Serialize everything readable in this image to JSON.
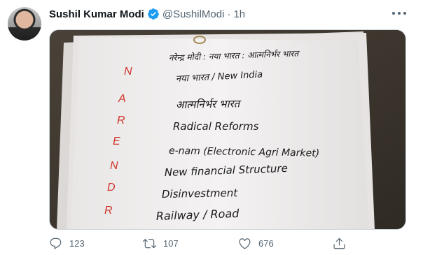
{
  "tweet": {
    "author_name": "Sushil Kumar Modi",
    "handle": "@SushilModi",
    "separator": "·",
    "time": "1h"
  },
  "note": {
    "acrostic_letters": [
      "N",
      "A",
      "R",
      "E",
      "N",
      "D",
      "R"
    ],
    "line1": "नरेन्द्र मोदी : नया भारत : आत्मनिर्भर भारत",
    "line2": "नया भारत / New India",
    "line3": "आत्मनिर्भर भारत",
    "line4": "Radical Reforms",
    "line5": "e-nam (Electronic Agri Market)",
    "line6": "New financial Structure",
    "line7": "Disinvestment",
    "line8": "Railway / Road"
  },
  "actions": {
    "replies": "123",
    "retweets": "107",
    "likes": "676"
  },
  "colors": {
    "accent": "#1d9bf0",
    "muted": "#536471",
    "ink_red": "#d0342c",
    "ink_black": "#1a1a1a"
  }
}
